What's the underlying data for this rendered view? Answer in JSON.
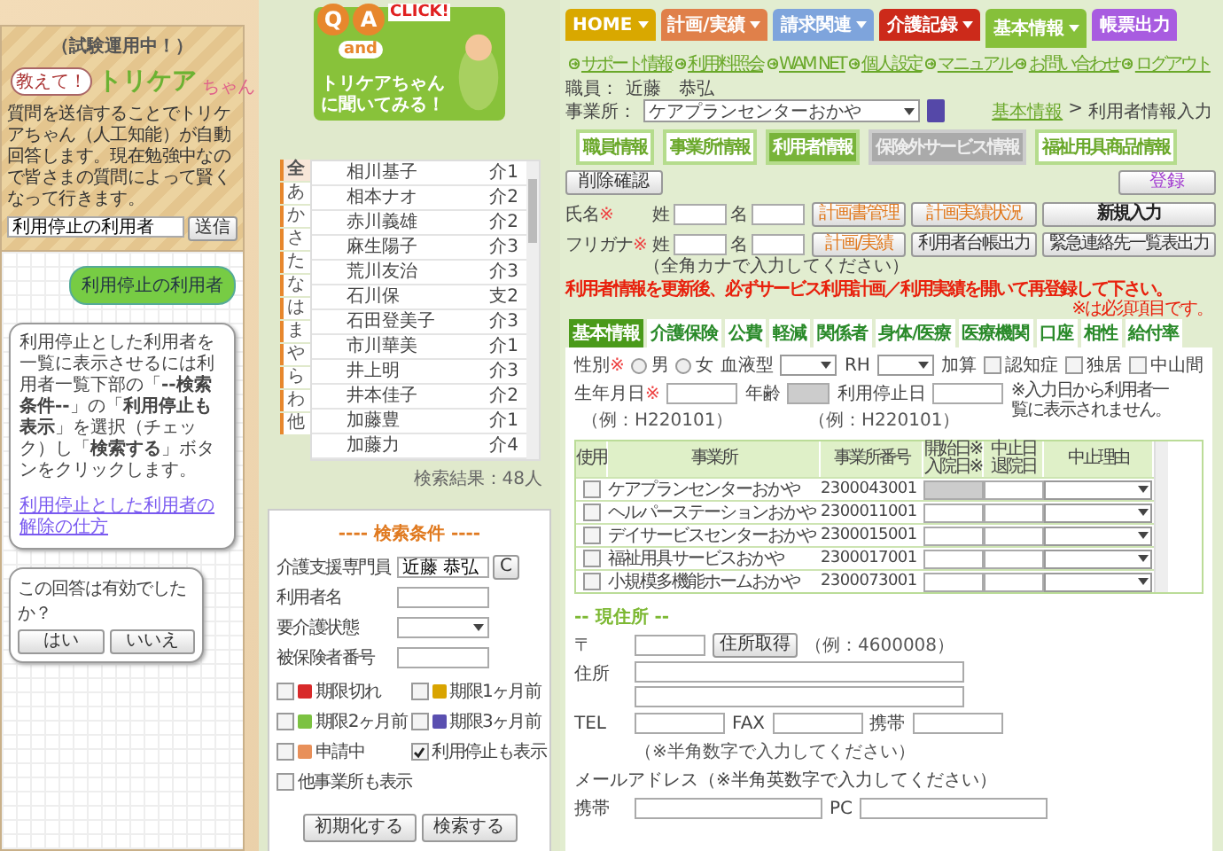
{
  "chat": {
    "status": "（試験運用中！）",
    "logo_words": [
      "教えて！",
      "トリケア",
      "ちゃん"
    ],
    "intro": "質問を送信することでトリケアちゃん（人工知能）が自動回答します。現在勉強中なので皆さまの質問によって賢くなって行きます。",
    "question_value": "利用停止の利用者",
    "send_button": "送信",
    "messages": [
      {
        "kind": "user",
        "text": "利用停止の利用者"
      },
      {
        "kind": "bot",
        "text": "利用停止とした利用者を一覧に表示させるには利用者一覧下部の「**--検索条件--**」の「**利用停止も表示**」を選択（チェック）し「**検索する**」ボタンをクリックします。",
        "link": "利用停止とした利用者の解除の仕方"
      }
    ],
    "feedback": {
      "question": "この回答は有効でしたか？",
      "buttons": [
        "はい",
        "いいえ"
      ]
    }
  },
  "qa_banner": {
    "q": "Q",
    "a": "A",
    "click": "CLICK!",
    "and": "and",
    "text": "トリケアちゃんに聞いてみる！"
  },
  "kana_tabs": [
    {
      "label": "全",
      "selected": true
    },
    {
      "label": "あ",
      "selected": false
    },
    {
      "label": "か",
      "selected": false
    },
    {
      "label": "さ",
      "selected": false
    },
    {
      "label": "た",
      "selected": false
    },
    {
      "label": "な",
      "selected": false
    },
    {
      "label": "は",
      "selected": false
    },
    {
      "label": "ま",
      "selected": false
    },
    {
      "label": "や",
      "selected": false
    },
    {
      "label": "ら",
      "selected": false
    },
    {
      "label": "わ",
      "selected": false
    },
    {
      "label": "他",
      "selected": false
    }
  ],
  "clients": [
    {
      "name": "相川基子",
      "care_level": "介1"
    },
    {
      "name": "相本ナオ",
      "care_level": "介2"
    },
    {
      "name": "赤川義雄",
      "care_level": "介2"
    },
    {
      "name": "麻生陽子",
      "care_level": "介3"
    },
    {
      "name": "荒川友治",
      "care_level": "介3"
    },
    {
      "name": "石川保",
      "care_level": "支2"
    },
    {
      "name": "石田登美子",
      "care_level": "介3"
    },
    {
      "name": "市川華美",
      "care_level": "介1"
    },
    {
      "name": "井上明",
      "care_level": "介3"
    },
    {
      "name": "井本佳子",
      "care_level": "介2"
    },
    {
      "name": "加藤豊",
      "care_level": "介1"
    },
    {
      "name": "加藤力",
      "care_level": "介4"
    }
  ],
  "result_count": "検索結果：48人",
  "search": {
    "title": "---- 検索条件 ----",
    "fields": [
      {
        "label": "介護支援専門員",
        "kind": "text",
        "value": "近藤 恭弘",
        "clear": "C"
      },
      {
        "label": "利用者名",
        "kind": "text"
      },
      {
        "label": "要介護状態",
        "kind": "select"
      },
      {
        "label": "被保険者番号",
        "kind": "text"
      }
    ],
    "filters": [
      {
        "label": "期限切れ",
        "checked": false,
        "color": "#d82a2a"
      },
      {
        "label": "期限1ヶ月前",
        "checked": false,
        "color": "#d9a400"
      },
      {
        "label": "期限2ヶ月前",
        "checked": false,
        "color": "#7cc242"
      },
      {
        "label": "期限3ヶ月前",
        "checked": false,
        "color": "#5a4fb0"
      },
      {
        "label": "申請中",
        "checked": false,
        "color": "#e8905a"
      },
      {
        "label": "利用停止も表示",
        "checked": true
      },
      {
        "label": "他事業所も表示",
        "checked": false
      }
    ],
    "buttons": [
      "初期化する",
      "検索する"
    ]
  },
  "nav_tabs": [
    {
      "label": "HOME",
      "color": "#d9a800",
      "selected": false,
      "menu": true
    },
    {
      "label": "計画/実績",
      "color": "#e0804a",
      "selected": false,
      "menu": true
    },
    {
      "label": "請求関連",
      "color": "#7ea4dc",
      "selected": false,
      "menu": true
    },
    {
      "label": "介護記録",
      "color": "#cc2a1a",
      "selected": false,
      "menu": true
    },
    {
      "label": "基本情報",
      "color": "#86c03a",
      "selected": true,
      "menu": true
    },
    {
      "label": "帳票出力",
      "color": "#a85ce0",
      "selected": false,
      "menu": false
    }
  ],
  "links": [
    "サポート情報",
    "利用料照会",
    "WAM NET",
    "個人設定",
    "マニュアル",
    "お問い合わせ",
    "ログアウト"
  ],
  "staff": {
    "label": "職員：",
    "value": "近藤　恭弘"
  },
  "office": {
    "label": "事業所：",
    "value": "ケアプランセンターおかや"
  },
  "breadcrumb": {
    "link": "基本情報",
    "separator": ">",
    "current": "利用者情報入力"
  },
  "section_tabs": [
    {
      "label": "職員情報",
      "selected": false,
      "disabled": false
    },
    {
      "label": "事業所情報",
      "selected": false,
      "disabled": false
    },
    {
      "label": "利用者情報",
      "selected": true,
      "disabled": false
    },
    {
      "label": "保険外サービス情報",
      "selected": false,
      "disabled": true
    },
    {
      "label": "福祉用具商品情報",
      "selected": false,
      "disabled": false
    }
  ],
  "delete_button": "削除確認",
  "register_button": "登録",
  "name_row": {
    "label": "氏名",
    "required": "※",
    "surname": "姓",
    "given": "名"
  },
  "kana_row": {
    "label": "フリガナ",
    "required": "※",
    "surname": "姓",
    "given": "名",
    "note": "（全角カナで入力してください）"
  },
  "action_buttons": [
    {
      "label": "計画書管理",
      "kind": "accent"
    },
    {
      "label": "計画実績状況",
      "kind": "accent"
    },
    {
      "label": "新規入力",
      "kind": "strong"
    },
    {
      "label": "計画/実績",
      "kind": "accent"
    },
    {
      "label": "利用者台帳出力",
      "kind": "plain"
    },
    {
      "label": "緊急連絡先一覧表出力",
      "kind": "plain"
    }
  ],
  "notice": "利用者情報を更新後、必ずサービス利用計画／利用実績を開いて再登録して下さい。",
  "required_note": "※は必須項目です。",
  "form_tabs": [
    {
      "label": "基本情報",
      "selected": true
    },
    {
      "label": "介護保険",
      "selected": false
    },
    {
      "label": "公費",
      "selected": false
    },
    {
      "label": "軽減",
      "selected": false
    },
    {
      "label": "関係者",
      "selected": false
    },
    {
      "label": "身体/医療",
      "selected": false
    },
    {
      "label": "医療機関",
      "selected": false
    },
    {
      "label": "口座",
      "selected": false
    },
    {
      "label": "相性",
      "selected": false
    },
    {
      "label": "給付率",
      "selected": false
    }
  ],
  "basic": {
    "gender_label": "性別",
    "required": "※",
    "genders": [
      {
        "label": "男",
        "selected": false
      },
      {
        "label": "女",
        "selected": false
      }
    ],
    "blood_label": "血液型",
    "rh_label": "RH",
    "addon_label": "加算",
    "addons": [
      {
        "label": "認知症",
        "checked": false
      },
      {
        "label": "独居",
        "checked": false
      },
      {
        "label": "中山間",
        "checked": false
      }
    ],
    "birth_label": "生年月日",
    "age_label": "年齢",
    "stop_label": "利用停止日",
    "stop_note": "※入力日から利用者一覧に表示されません。",
    "example_birth": "（例：H220101）",
    "example_stop": "（例：H220101）"
  },
  "offices": {
    "columns": [
      {
        "lines": [
          "使用"
        ]
      },
      {
        "lines": [
          "事業所"
        ]
      },
      {
        "lines": [
          "事業所番号"
        ]
      },
      {
        "lines": [
          "開始日※",
          "入院日※"
        ]
      },
      {
        "lines": [
          "中止日",
          "退院日"
        ]
      },
      {
        "lines": [
          "中止理由"
        ]
      }
    ],
    "rows": [
      {
        "checked": false,
        "name": "ケアプランセンターおかや",
        "number": "2300043001",
        "start_disabled": true
      },
      {
        "checked": false,
        "name": "ヘルパーステーションおかや",
        "number": "2300011001",
        "start_disabled": false
      },
      {
        "checked": false,
        "name": "デイサービスセンターおかや",
        "number": "2300015001",
        "start_disabled": false
      },
      {
        "checked": false,
        "name": "福祉用具サービスおかや",
        "number": "2300017001",
        "start_disabled": false
      },
      {
        "checked": false,
        "name": "小規模多機能ホームおかや",
        "number": "2300073001",
        "start_disabled": false
      }
    ]
  },
  "address": {
    "title": "-- 現住所 --",
    "postal_label": "〒",
    "lookup_button": "住所取得",
    "postal_example": "（例：4600008）",
    "address_label": "住所",
    "tel_label": "TEL",
    "fax_label": "FAX",
    "mobile_label": "携帯",
    "phone_note": "（※半角数字で入力してください）",
    "email_label": "メールアドレス（※半角英数字で入力してください）",
    "email_mobile_label": "携帯",
    "email_pc_label": "PC"
  }
}
